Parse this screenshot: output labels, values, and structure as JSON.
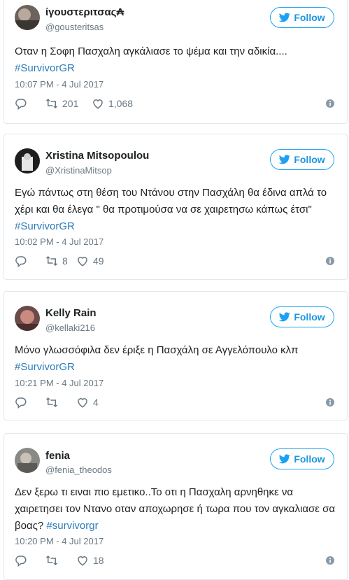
{
  "follow_label": "Follow",
  "colors": {
    "accent": "#1da1f2",
    "link": "#2b7bb9",
    "muted": "#697882"
  },
  "tweets": [
    {
      "name": "ίγουστεριτσας₳",
      "handle": "@gousteritsas",
      "text": "Οταν η Σοφη Πασχαλη αγκάλιασε το ψέμα και την αδικία....",
      "hashtag": "#SurvivorGR",
      "time": "10:07 PM - 4 Jul 2017",
      "retweets": "201",
      "likes": "1,068"
    },
    {
      "name": "Xristina Mitsopoulou",
      "handle": "@XristinaMitsop",
      "text": "Εγώ πάντως στη θέση του Ντάνου στην Πασχάλη θα έδινα απλά το χέρι και θα έλεγα \" θα προτιμούσα να σε χαιρετησω κάπως έτσι\"",
      "hashtag": "#SurvivorGR",
      "time": "10:02 PM - 4 Jul 2017",
      "retweets": "8",
      "likes": "49"
    },
    {
      "name": "Kelly Rain",
      "handle": "@kellaki216",
      "text": "Μόνο γλωσσόφιλα δεν έριξε η Πασχάλη σε Αγγελόπουλο κλπ",
      "hashtag": "#SurvivorGR",
      "time": "10:21 PM - 4 Jul 2017",
      "retweets": "",
      "likes": "4"
    },
    {
      "name": "fenia",
      "handle": "@fenia_theodos",
      "text": "Δεν ξερω τι ειναι πιο εμετικο..Το οτι η Πασχαλη αρνηθηκε να χαιρετησει τον Ντανο οταν αποχωρησε ή τωρα που τον αγκαλιασε σα βοας?",
      "hashtag": "#survivorgr",
      "time": "10:20 PM - 4 Jul 2017",
      "retweets": "",
      "likes": "18"
    }
  ]
}
